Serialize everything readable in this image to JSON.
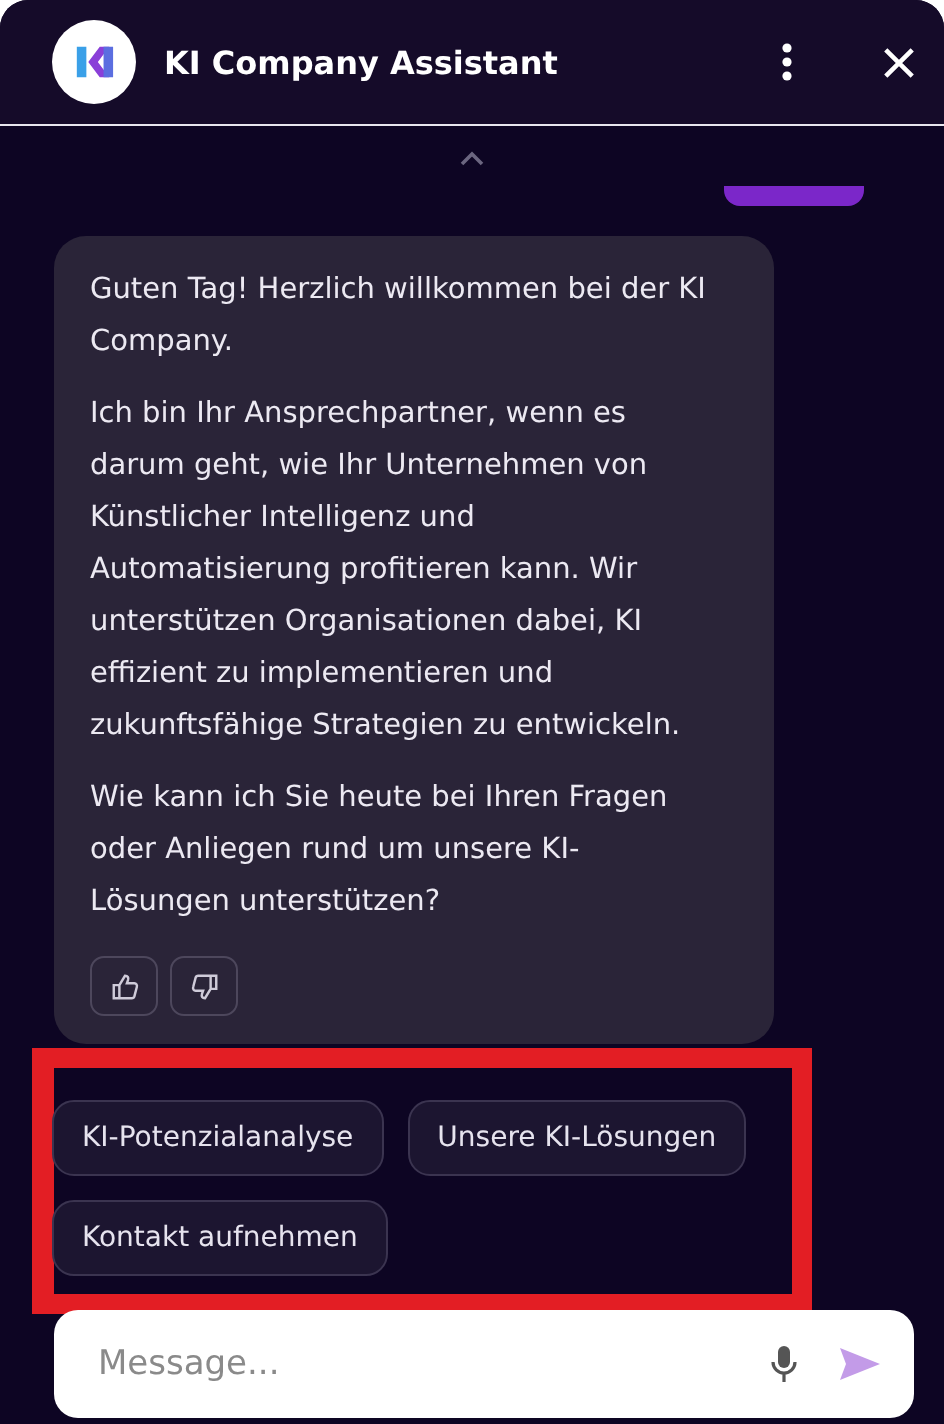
{
  "header": {
    "title": "KI Company Assistant"
  },
  "message": {
    "paragraphs": [
      "Guten Tag! Herzlich willkommen bei der KI Company.",
      "Ich bin Ihr Ansprechpartner, wenn es darum geht, wie Ihr Unternehmen von Künstlicher Intelligenz und Automatisierung profitieren kann. Wir unterstützen Organisationen dabei, KI effizient zu implementieren und zukunftsfähige Strategien zu entwickeln.",
      "Wie kann ich Sie heute bei Ihren Fragen oder Anliegen rund um unsere KI-Lösungen unterstützen?"
    ]
  },
  "suggestions": [
    "KI-Potenzialanalyse",
    "Unsere KI-Lösungen",
    "Kontakt aufnehmen"
  ],
  "composer": {
    "placeholder": "Message..."
  }
}
